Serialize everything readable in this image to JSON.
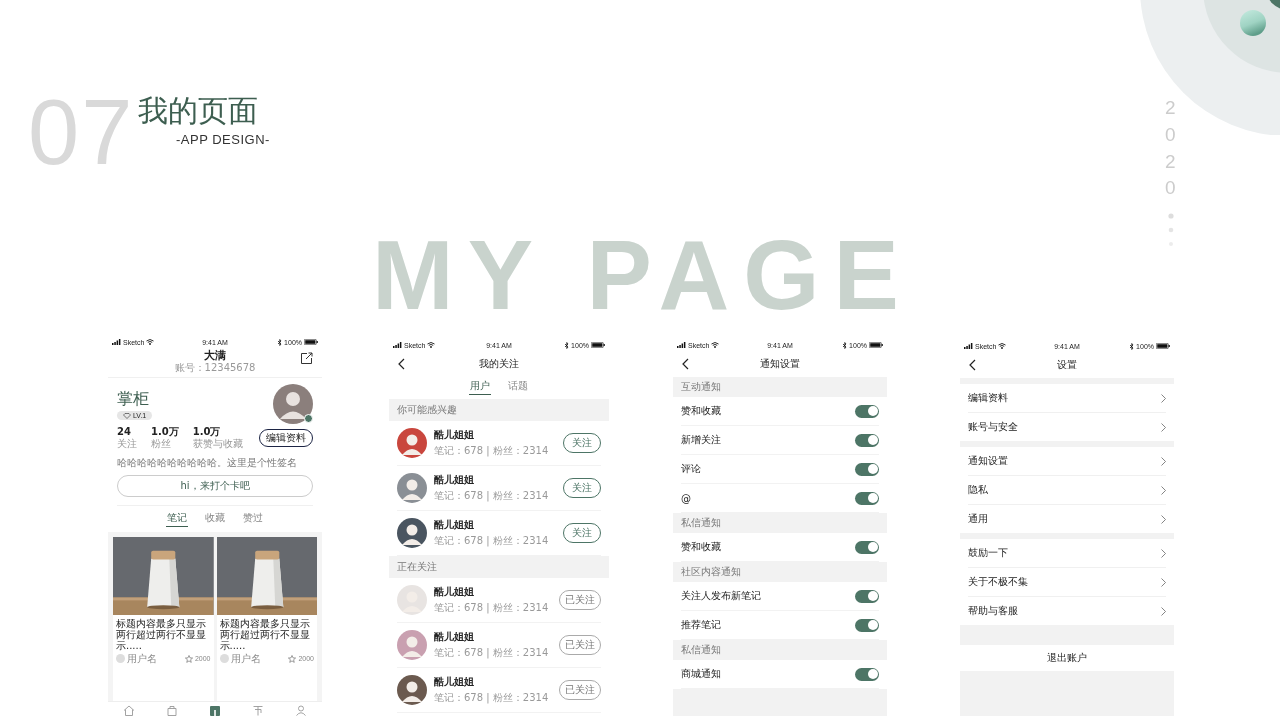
{
  "slide": {
    "number": "07",
    "title": "我的页面",
    "subtitle": "-APP DESIGN-",
    "watermark": "MY PAGE",
    "year_digits": [
      "2",
      "0",
      "2",
      "0"
    ]
  },
  "screens": [
    {
      "kind": "profile",
      "status": {
        "carrier": "Sketch",
        "time": "9:41 AM",
        "battery": "100%"
      },
      "header": {
        "title": "大满",
        "account": "账号：12345678"
      },
      "user": {
        "name": "掌柜",
        "level": "LV.1"
      },
      "stats": [
        {
          "value": "24",
          "label": "关注"
        },
        {
          "value": "1.0万",
          "label": "粉丝"
        },
        {
          "value": "1.0万",
          "label": "获赞与收藏"
        }
      ],
      "edit_button": "编辑资料",
      "bio": "哈哈哈哈哈哈哈哈哈哈。这里是个性签名",
      "checkin_button": "hi，来打个卡吧",
      "tabs": [
        {
          "label": "笔记",
          "selected": true
        },
        {
          "label": "收藏",
          "selected": false
        },
        {
          "label": "赞过",
          "selected": false
        }
      ],
      "notes": [
        {
          "title": "标题内容最多只显示两行超过两行不显显示.....",
          "author": "用户名",
          "likes": "2000"
        },
        {
          "title": "标题内容最多只显示两行超过两行不显显示.....",
          "author": "用户名",
          "likes": "2000"
        }
      ],
      "nav": [
        {
          "selected": false
        },
        {
          "selected": false
        },
        {
          "selected": true
        },
        {
          "selected": false
        },
        {
          "selected": false
        }
      ]
    },
    {
      "kind": "following",
      "status": {
        "carrier": "Sketch",
        "time": "9:41 AM",
        "battery": "100%"
      },
      "title": "我的关注",
      "tabs": [
        {
          "label": "用户",
          "selected": true
        },
        {
          "label": "话题",
          "selected": false
        }
      ],
      "sections": [
        {
          "title": "你可能感兴趣",
          "users": [
            {
              "name": "酷儿姐姐",
              "stats": "笔记：678 | 粉丝：2314",
              "button": "关注",
              "followed": false
            },
            {
              "name": "酷儿姐姐",
              "stats": "笔记：678 | 粉丝：2314",
              "button": "关注",
              "followed": false
            },
            {
              "name": "酷儿姐姐",
              "stats": "笔记：678 | 粉丝：2314",
              "button": "关注",
              "followed": false
            }
          ]
        },
        {
          "title": "正在关注",
          "users": [
            {
              "name": "酷儿姐姐",
              "stats": "笔记：678 | 粉丝：2314",
              "button": "已关注",
              "followed": true
            },
            {
              "name": "酷儿姐姐",
              "stats": "笔记：678 | 粉丝：2314",
              "button": "已关注",
              "followed": true
            },
            {
              "name": "酷儿姐姐",
              "stats": "笔记：678 | 粉丝：2314",
              "button": "已关注",
              "followed": true
            }
          ]
        }
      ]
    },
    {
      "kind": "notifications",
      "status": {
        "carrier": "Sketch",
        "time": "9:41 AM",
        "battery": "100%"
      },
      "title": "通知设置",
      "groups": [
        {
          "title": "互动通知",
          "items": [
            {
              "label": "赞和收藏",
              "on": true
            },
            {
              "label": "新增关注",
              "on": true
            },
            {
              "label": "评论",
              "on": true
            },
            {
              "label": "@",
              "on": true
            }
          ]
        },
        {
          "title": "私信通知",
          "items": [
            {
              "label": "赞和收藏",
              "on": true
            }
          ]
        },
        {
          "title": "社区内容通知",
          "items": [
            {
              "label": "关注人发布新笔记",
              "on": true
            },
            {
              "label": "推荐笔记",
              "on": true
            }
          ]
        },
        {
          "title": "私信通知",
          "items": [
            {
              "label": "商城通知",
              "on": true
            }
          ]
        }
      ]
    },
    {
      "kind": "settings",
      "status": {
        "carrier": "Sketch",
        "time": "9:41 AM",
        "battery": "100%"
      },
      "title": "设置",
      "groups": [
        [
          "编辑资料",
          "账号与安全"
        ],
        [
          "通知设置",
          "隐私",
          "通用"
        ],
        [
          "鼓励一下",
          "关于不极不集",
          "帮助与客服"
        ]
      ],
      "logout": "退出账户"
    }
  ]
}
